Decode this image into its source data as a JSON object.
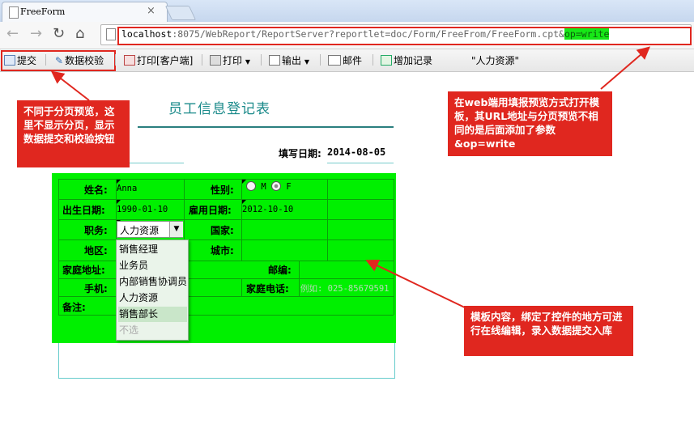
{
  "browser": {
    "tab_title": "FreeForm",
    "tab_close": "×",
    "url_host": "localhost",
    "url_rest": ":8075/WebReport/ReportServer?reportlet=doc/Form/FreeFrom/FreeForm.cpt",
    "url_amp": "&",
    "url_op": "op=write"
  },
  "toolbar": {
    "submit": "提交",
    "validate": "数据校验",
    "print_client": "打印[客户端]",
    "print": "打印",
    "export": "输出",
    "email": "邮件",
    "add_record": "增加记录",
    "hr_tag": "\"人力资源\""
  },
  "report": {
    "title": "员工信息登记表",
    "date_label": "填写日期:",
    "date_value": "2014-08-05",
    "labels": {
      "name": "姓名:",
      "gender": "性别:",
      "birth": "出生日期:",
      "hire": "雇用日期:",
      "position": "职务:",
      "country": "国家:",
      "region": "地区:",
      "city": "城市:",
      "address": "家庭地址:",
      "postcode": "邮编:",
      "mobile": "手机:",
      "home_phone": "家庭电话:",
      "remark": "备注:"
    },
    "values": {
      "name": "Anna",
      "gender_m": "M",
      "gender_f": "F",
      "birth": "1990-01-10",
      "hire": "2012-10-10",
      "position": "人力资源",
      "home_phone_placeholder": "例如: 025-85679591"
    },
    "position_options": [
      "销售经理",
      "业务员",
      "内部销售协调员",
      "人力资源",
      "销售部长",
      "不选"
    ]
  },
  "callouts": {
    "paging": "不同于分页预览，这里不显示分页，显示数据提交和校验按钮",
    "url": "在web端用填报预览方式打开模板，其URL地址与分页预览不相同的是后面添加了参数&op=write",
    "content": "模板内容，绑定了控件的地方可进行在线编辑，录入数据提交入库"
  },
  "colors": {
    "highlight_red": "#e0271f",
    "form_green": "#00f000",
    "title_teal": "#1a8a8a"
  }
}
